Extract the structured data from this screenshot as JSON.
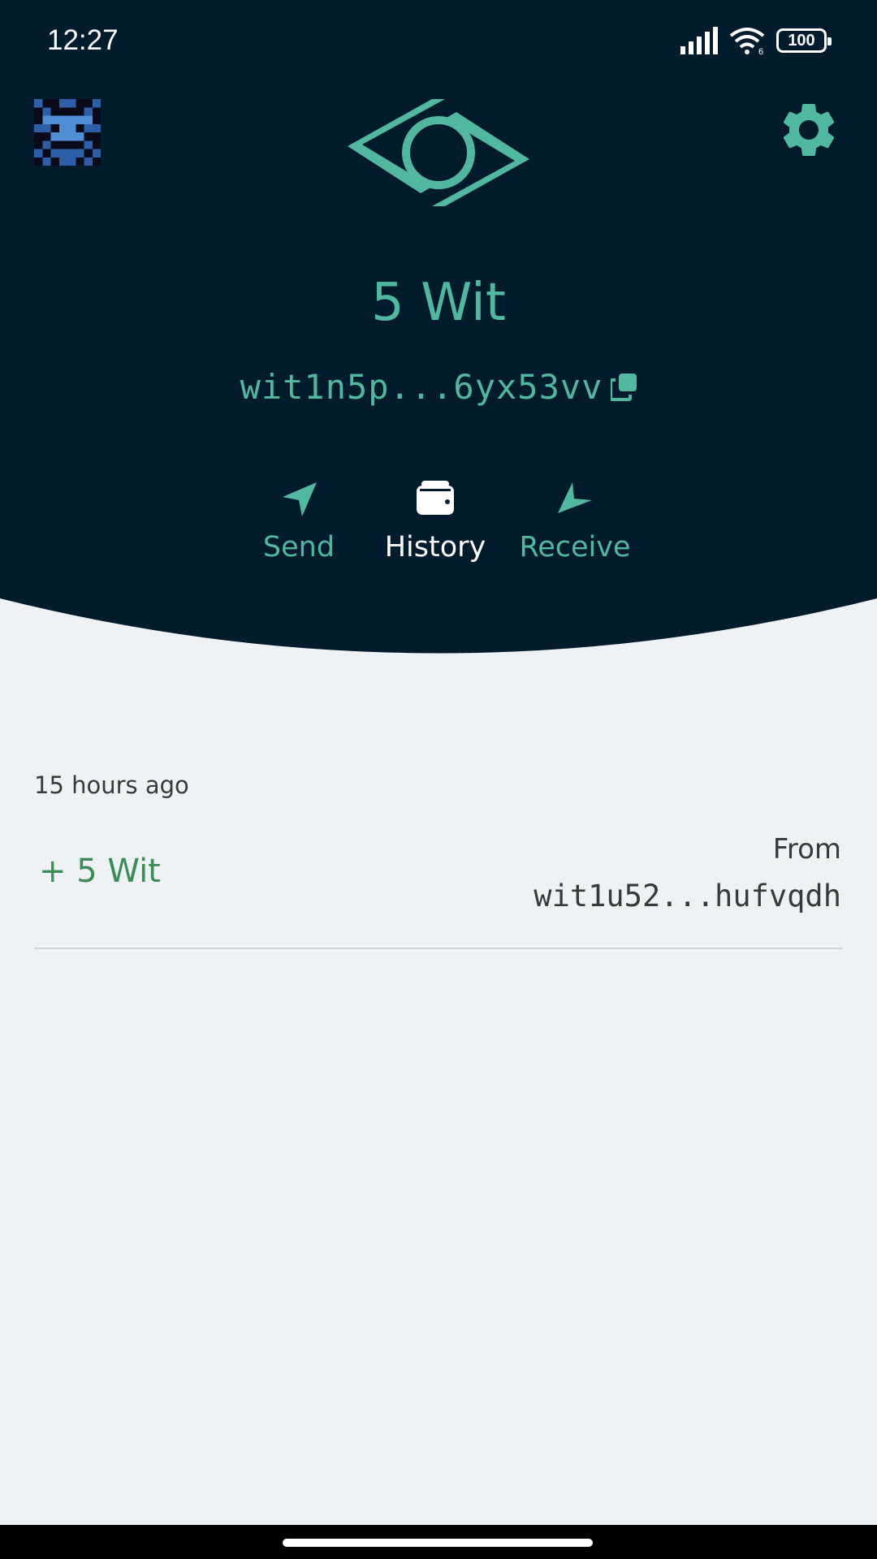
{
  "status_bar": {
    "time": "12:27",
    "battery": "100",
    "wifi_badge": "6",
    "icons": [
      "signal-icon",
      "wifi-icon",
      "battery-icon"
    ]
  },
  "header": {
    "avatar_icon": "pixel-avatar-icon",
    "logo_icon": "witnet-eye-logo",
    "settings_icon": "gear-icon",
    "balance": "5 Wit",
    "address": "wit1n5p...6yx53vv",
    "copy_icon": "copy-icon"
  },
  "tabs": [
    {
      "label": "Send",
      "icon": "send-arrow-icon",
      "active": false
    },
    {
      "label": "History",
      "icon": "wallet-icon",
      "active": true
    },
    {
      "label": "Receive",
      "icon": "receive-arrow-icon",
      "active": false
    }
  ],
  "transactions": [
    {
      "date": "15 hours ago",
      "amount": "+ 5 Wit",
      "direction_label": "From",
      "counterparty": "wit1u52...hufvqdh"
    }
  ],
  "colors": {
    "header_bg": "#021c2e",
    "accent": "#52b7a0",
    "positive": "#3a8d56",
    "page_bg": "#eff2f5"
  }
}
